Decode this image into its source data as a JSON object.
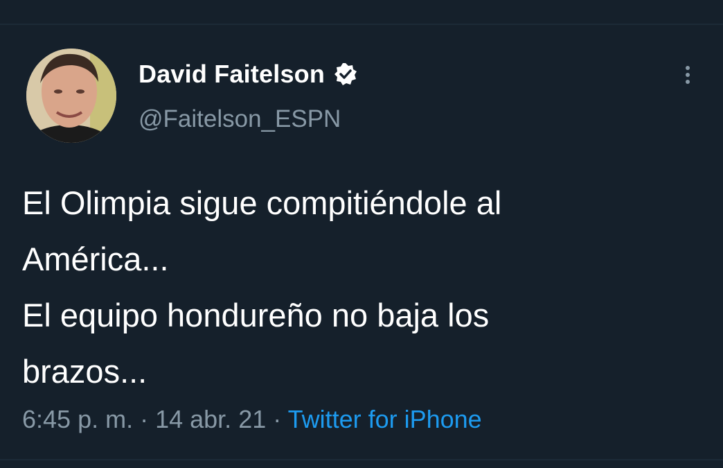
{
  "tweet": {
    "author": {
      "display_name": "David Faitelson",
      "handle": "@Faitelson_ESPN",
      "verified": true
    },
    "text": "El Olimpia sigue compitiéndole al\nAmérica...\nEl equipo hondureño no baja los\nbrazos...",
    "time": "6:45 p. m.",
    "separator": " · ",
    "date": "14 abr. 21",
    "source": "Twitter for iPhone"
  },
  "icons": {
    "verified": "verified-badge-icon",
    "more": "more-options-icon"
  },
  "colors": {
    "background": "#15202b",
    "secondary_text": "#8899a6",
    "link": "#1d9bf0"
  }
}
